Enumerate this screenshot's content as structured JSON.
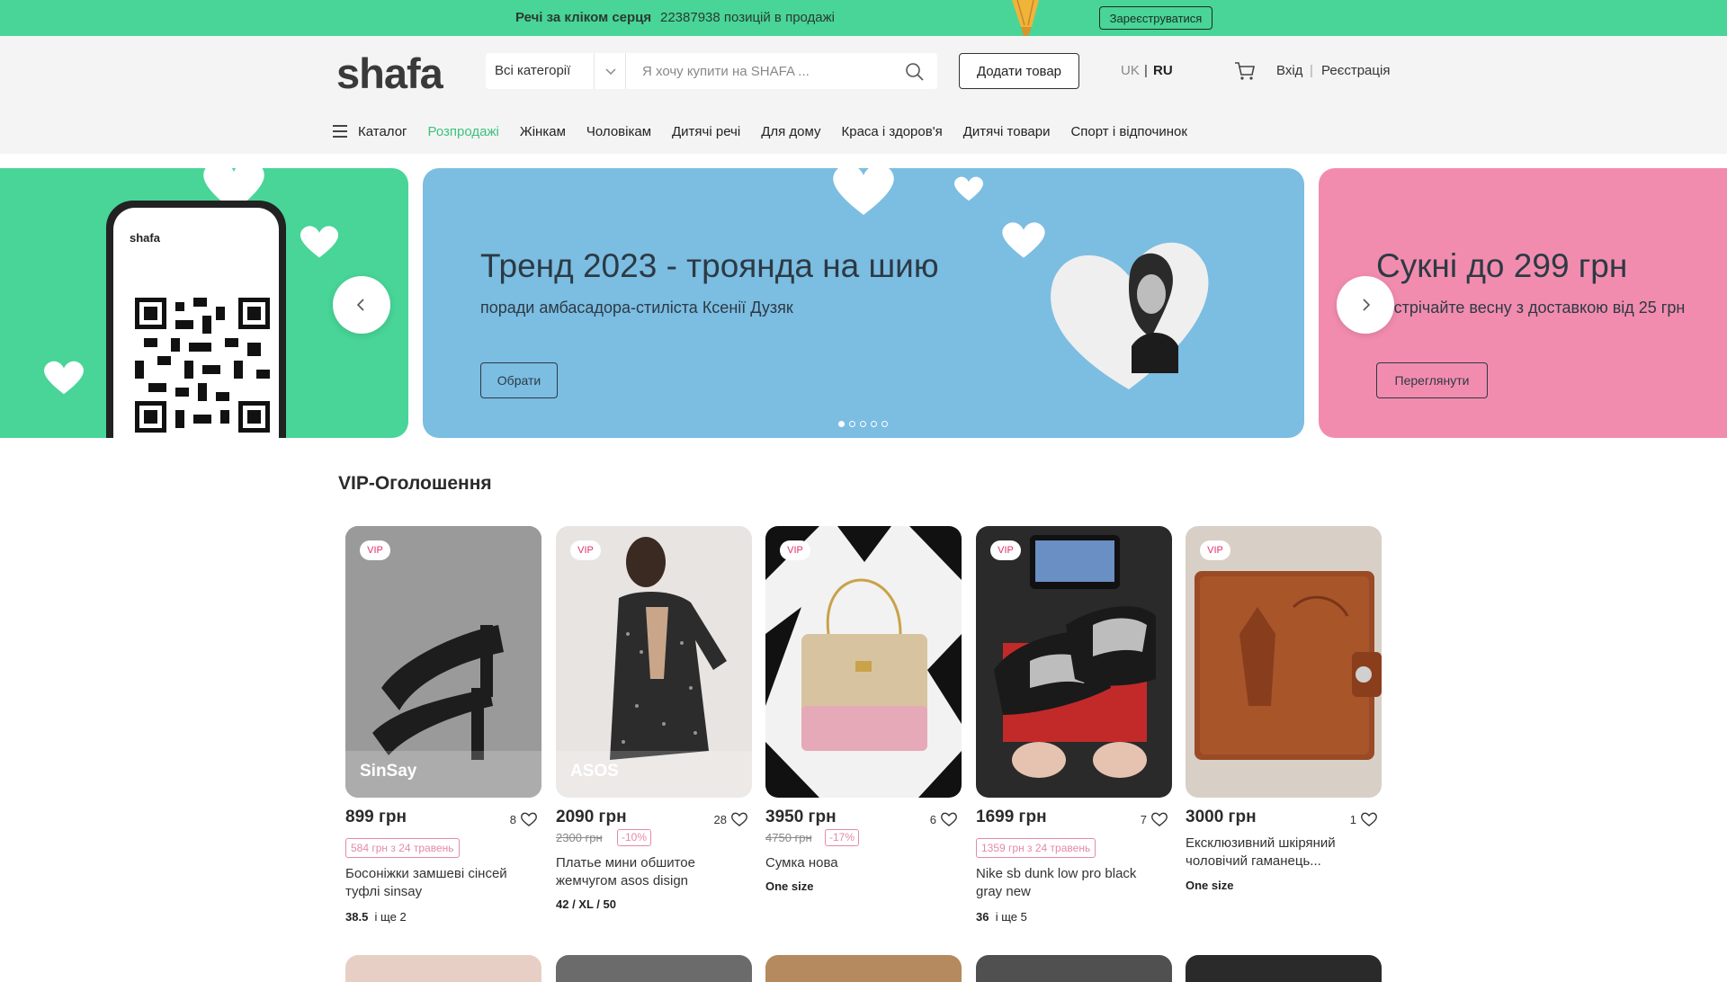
{
  "promo_bar": {
    "text": "Речі за кліком серця",
    "count": "22387938 позицій в продажі",
    "button": "Зареєструватися",
    "accent": "#48d597"
  },
  "header": {
    "logo": "shafa",
    "search": {
      "category": "Всі категорії",
      "placeholder": "Я хочу купити на SHAFA ...",
      "value": ""
    },
    "add_button": "Додати товар",
    "lang": {
      "uk": "UK",
      "sep": "|",
      "ru": "RU",
      "active": "RU"
    },
    "login": "Вхід",
    "auth_sep": "|",
    "register": "Реєстрація"
  },
  "nav": {
    "catalog": "Каталог",
    "items": [
      "Розпродажі",
      "Жінкам",
      "Чоловікам",
      "Дитячі речі",
      "Для дому",
      "Краса і здоров'я",
      "Дитячі товари",
      "Спорт і відпочинок"
    ]
  },
  "hero": {
    "phone_brand": "shafa",
    "main": {
      "title": "Тренд 2023 - троянда на шию",
      "subtitle": "поради амбасадора-стиліста Ксенії Дузяк",
      "button": "Обрати",
      "bg": "#7cbde2"
    },
    "right": {
      "title": "Сукні до 299 грн",
      "subtitle": "Зустрічайте весну з доставкою від 25 грн",
      "button": "Переглянути",
      "bg": "#f28caf"
    },
    "left_bg": "#48d597",
    "dots": 5,
    "active_dot": 1
  },
  "vip": {
    "title": "VIP-Оголошення",
    "badge": "VIP",
    "cards": [
      {
        "brand": "SinSay",
        "price": "899 грн",
        "likes": "8",
        "promo": "584 грн з 24 травень",
        "title": "Босоніжки замшеві сінсей туфлі sinsay",
        "size": "38.5",
        "size_more": "і ще 2"
      },
      {
        "brand": "ASOS",
        "price": "2090 грн",
        "likes": "28",
        "old_price": "2300 грн",
        "discount": "-10%",
        "title": "Платье мини обшитое жемчугом asos disign",
        "size": "42 / XL / 50"
      },
      {
        "brand": "",
        "price": "3950 грн",
        "likes": "6",
        "old_price": "4750 грн",
        "discount": "-17%",
        "title": "Сумка нова",
        "size": "One size"
      },
      {
        "brand": "",
        "price": "1699 грн",
        "likes": "7",
        "promo": "1359 грн з 24 травень",
        "title": "Nike sb dunk low pro black gray new",
        "size": "36",
        "size_more": "і ще 5"
      },
      {
        "brand": "",
        "price": "3000 грн",
        "likes": "1",
        "title": "Ексклюзивний шкіряний чоловічий гаманець...",
        "size": "One size"
      }
    ]
  }
}
